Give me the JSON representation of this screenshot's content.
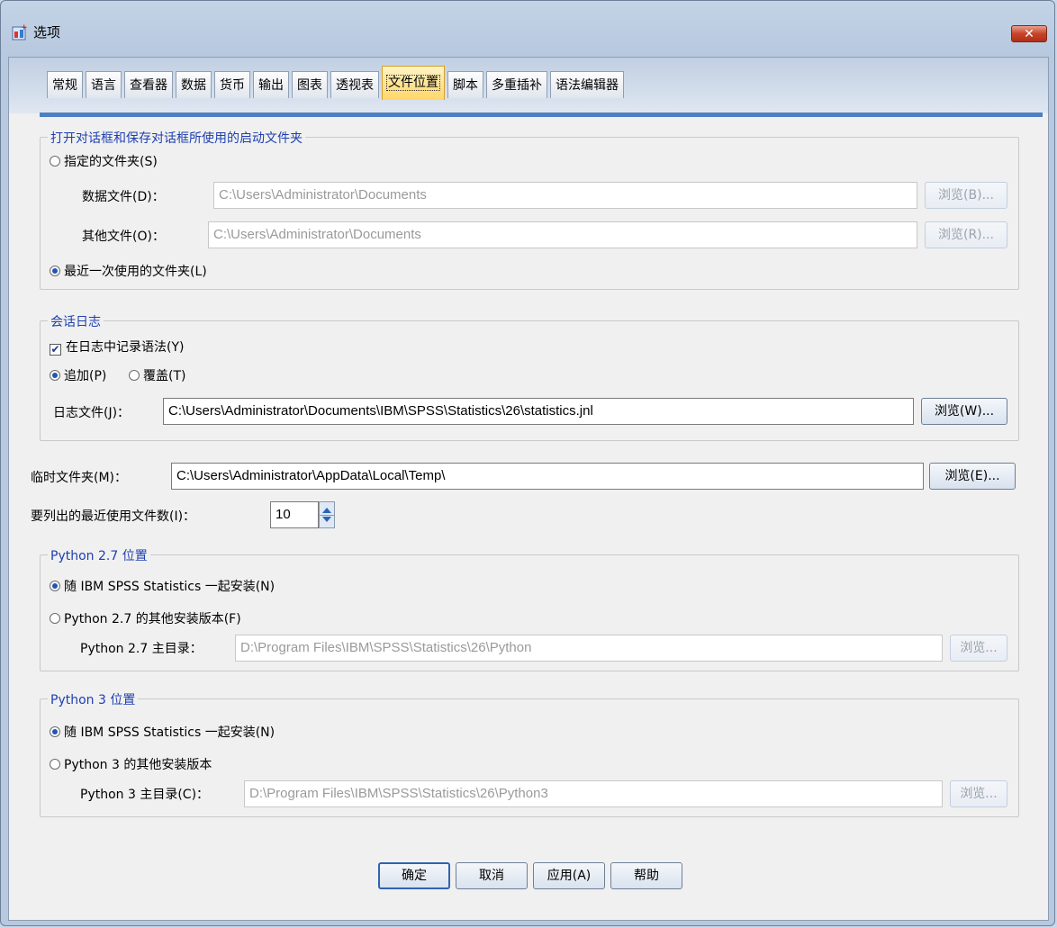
{
  "window": {
    "title": "选项",
    "close_label": "✕"
  },
  "tabs": [
    {
      "label": "常规"
    },
    {
      "label": "语言"
    },
    {
      "label": "查看器"
    },
    {
      "label": "数据"
    },
    {
      "label": "货币"
    },
    {
      "label": "输出"
    },
    {
      "label": "图表"
    },
    {
      "label": "透视表"
    },
    {
      "label": "文件位置",
      "active": true
    },
    {
      "label": "脚本"
    },
    {
      "label": "多重插补"
    },
    {
      "label": "语法编辑器"
    }
  ],
  "startup_folder": {
    "legend": "打开对话框和保存对话框所使用的启动文件夹",
    "specified_label": "指定的文件夹(S)",
    "data_files_label": "数据文件(D)：",
    "data_files_value": "C:\\Users\\Administrator\\Documents",
    "data_browse": "浏览(B)...",
    "other_files_label": "其他文件(O)：",
    "other_files_value": "C:\\Users\\Administrator\\Documents",
    "other_browse": "浏览(R)...",
    "last_used_label": "最近一次使用的文件夹(L)"
  },
  "session_journal": {
    "legend": "会话日志",
    "record_syntax_label": "在日志中记录语法(Y)",
    "append_label": "追加(P)",
    "overwrite_label": "覆盖(T)",
    "journal_file_label": "日志文件(J)：",
    "journal_file_value": "C:\\Users\\Administrator\\Documents\\IBM\\SPSS\\Statistics\\26\\statistics.jnl",
    "journal_browse": "浏览(W)..."
  },
  "temp": {
    "label": "临时文件夹(M)：",
    "value": "C:\\Users\\Administrator\\AppData\\Local\\Temp\\",
    "browse": "浏览(E)..."
  },
  "recent": {
    "label": "要列出的最近使用文件数(I)：",
    "value": "10"
  },
  "python27": {
    "legend": "Python 2.7 位置",
    "bundled_label": "随 IBM SPSS Statistics 一起安装(N)",
    "other_label": "Python 2.7 的其他安装版本(F)",
    "home_label": "Python 2.7 主目录：",
    "home_value": "D:\\Program Files\\IBM\\SPSS\\Statistics\\26\\Python",
    "browse": "浏览..."
  },
  "python3": {
    "legend": "Python 3 位置",
    "bundled_label": "随 IBM SPSS Statistics 一起安装(N)",
    "other_label": "Python 3 的其他安装版本",
    "home_label": "Python 3 主目录(C)：",
    "home_value": "D:\\Program Files\\IBM\\SPSS\\Statistics\\26\\Python3",
    "browse": "浏览..."
  },
  "footer": {
    "ok": "确定",
    "cancel": "取消",
    "apply": "应用(A)",
    "help": "帮助"
  }
}
